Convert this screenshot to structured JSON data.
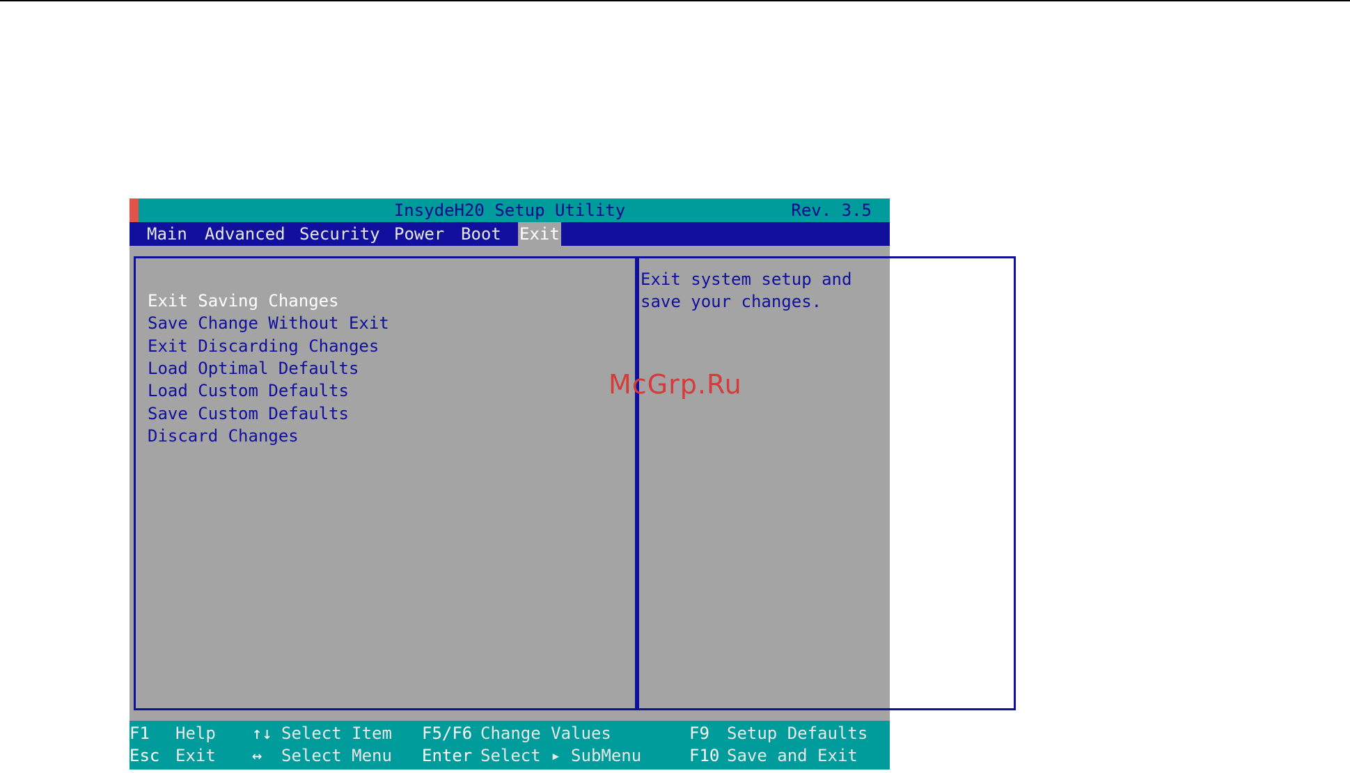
{
  "title": {
    "name": "InsydeH20 Setup Utility",
    "rev": "Rev. 3.5"
  },
  "menu": [
    "Main",
    "Advanced",
    "Security",
    "Power",
    "Boot",
    "Exit"
  ],
  "active_tab": "Exit",
  "options": [
    "Exit Saving Changes",
    "Save Change Without Exit",
    "Exit Discarding Changes",
    "Load Optimal Defaults",
    "Load Custom Defaults",
    "Save Custom Defaults",
    "Discard Changes"
  ],
  "selected_option": "Exit Saving Changes",
  "help": {
    "line1": "Exit system setup and",
    "line2": "save your changes."
  },
  "footer": {
    "row1": [
      {
        "key": "F1",
        "desc": "Help"
      },
      {
        "key": "↑↓",
        "desc": "Select Item"
      },
      {
        "key": "F5/F6",
        "desc": "Change Values"
      },
      {
        "key": "F9",
        "desc": "Setup Defaults"
      }
    ],
    "row2": [
      {
        "key": "Esc",
        "desc": "Exit"
      },
      {
        "key": "↔",
        "desc": "Select Menu"
      },
      {
        "key": "Enter",
        "desc": "Select ▸ SubMenu"
      },
      {
        "key": "F10",
        "desc": "Save and Exit"
      }
    ]
  },
  "watermark": "McGrp.Ru",
  "colors": {
    "teal": "#009b9b",
    "navy": "#10109c",
    "grey": "#a4a4a4",
    "red_edge": "#e2544a"
  }
}
